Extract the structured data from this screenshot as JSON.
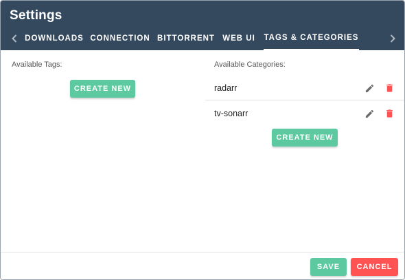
{
  "dialog": {
    "title": "Settings",
    "tabs": [
      {
        "label": "DOWNLOADS"
      },
      {
        "label": "CONNECTION"
      },
      {
        "label": "BITTORRENT"
      },
      {
        "label": "WEB UI"
      },
      {
        "label": "TAGS & CATEGORIES",
        "active": true
      }
    ],
    "icons": {
      "tab_prev": "chevron-left-icon",
      "tab_next": "chevron-right-icon",
      "edit": "pencil-icon",
      "delete": "trash-icon"
    }
  },
  "tags": {
    "label": "Available Tags:",
    "create_button": "CREATE NEW"
  },
  "categories": {
    "label": "Available Categories:",
    "items": [
      {
        "name": "radarr"
      },
      {
        "name": "tv-sonarr"
      }
    ],
    "create_button": "CREATE NEW"
  },
  "footer": {
    "save_label": "SAVE",
    "cancel_label": "CANCEL"
  },
  "colors": {
    "header_bg": "#35495e",
    "accent_green": "#5cc9a1",
    "danger_red": "#ff5252",
    "icon_gray": "#6b6b6b"
  }
}
